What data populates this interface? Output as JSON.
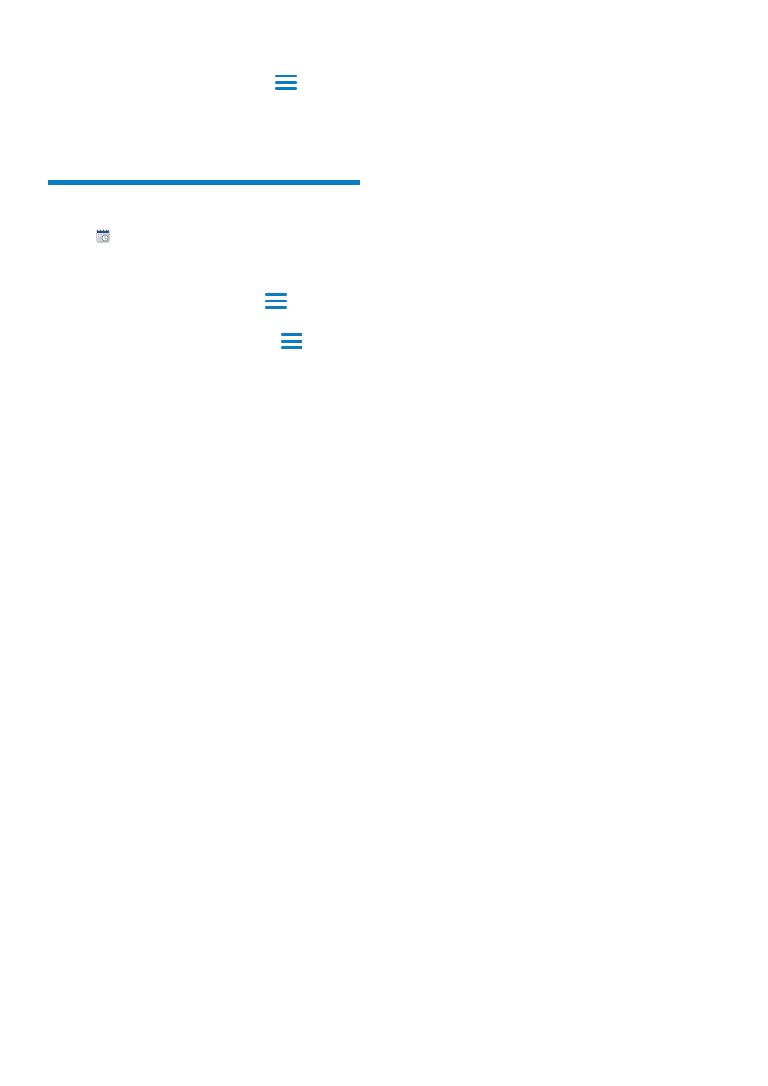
{
  "colors": {
    "accent": "#0a7dc2",
    "rule": "#0a7dc2",
    "icon_gray": "#9a9fa6",
    "icon_light": "#d7dbe0",
    "background": "#ffffff"
  },
  "icons": {
    "top_menu": "menu-icon",
    "app": "calendar-clock-icon",
    "menu_row_1": "menu-icon",
    "menu_row_2": "menu-icon"
  }
}
